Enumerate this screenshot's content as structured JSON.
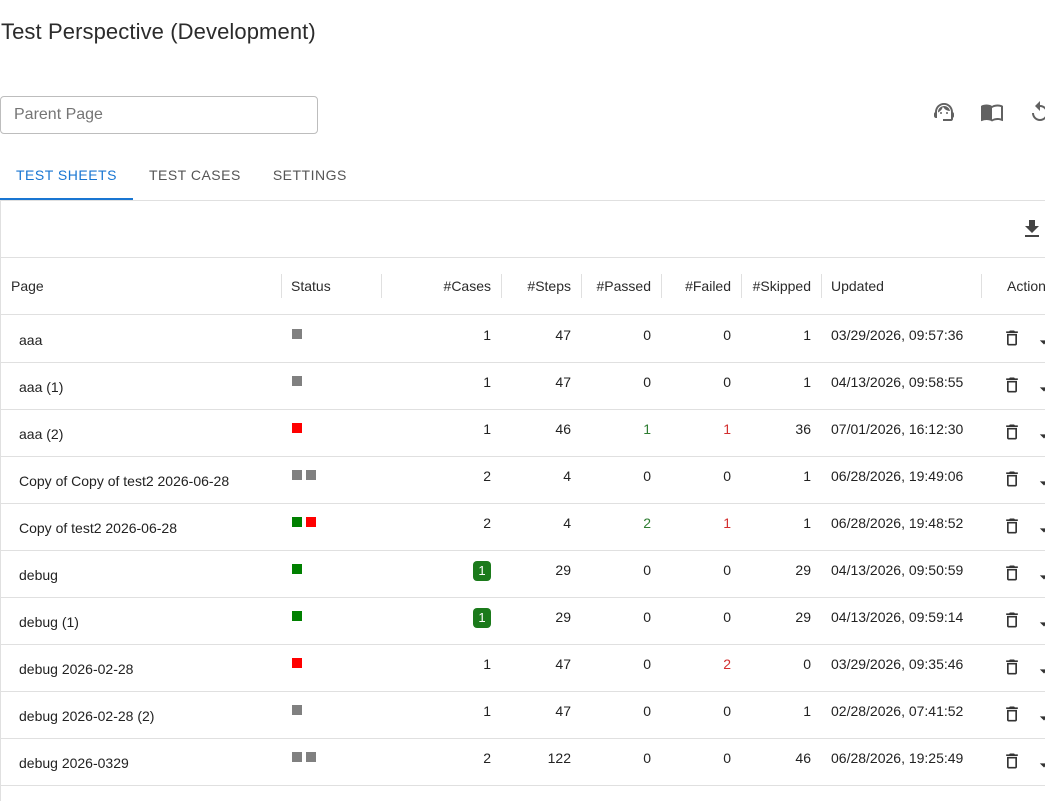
{
  "header": {
    "title": "Test Perspective (Development)"
  },
  "parent_input": {
    "placeholder": "Parent Page",
    "value": ""
  },
  "toolbar_icons": [
    "support-agent-icon",
    "book-icon",
    "refresh-icon"
  ],
  "tabs": [
    {
      "label": "TEST SHEETS",
      "active": true
    },
    {
      "label": "TEST CASES",
      "active": false
    },
    {
      "label": "SETTINGS",
      "active": false
    }
  ],
  "columns": {
    "page": "Page",
    "status": "Status",
    "cases": "#Cases",
    "steps": "#Steps",
    "passed": "#Passed",
    "failed": "#Failed",
    "skipped": "#Skipped",
    "updated": "Updated",
    "actions": "Action"
  },
  "colors": {
    "grey": "#808080",
    "green": "#008000",
    "red": "#ff0000",
    "accent": "#1976d2"
  },
  "rows": [
    {
      "page": "aaa",
      "status": [
        "grey"
      ],
      "cases": "1",
      "cases_badge": false,
      "steps": "47",
      "passed": "0",
      "failed": "0",
      "skipped": "1",
      "updated": "03/29/2026, 09:57:36"
    },
    {
      "page": "aaa (1)",
      "status": [
        "grey"
      ],
      "cases": "1",
      "cases_badge": false,
      "steps": "47",
      "passed": "0",
      "failed": "0",
      "skipped": "1",
      "updated": "04/13/2026, 09:58:55"
    },
    {
      "page": "aaa (2)",
      "status": [
        "red"
      ],
      "cases": "1",
      "cases_badge": false,
      "steps": "46",
      "passed": "1",
      "failed": "1",
      "skipped": "36",
      "updated": "07/01/2026, 16:12:30"
    },
    {
      "page": "Copy of Copy of test2 2026-06-28",
      "status": [
        "grey",
        "grey"
      ],
      "cases": "2",
      "cases_badge": false,
      "steps": "4",
      "passed": "0",
      "failed": "0",
      "skipped": "1",
      "updated": "06/28/2026, 19:49:06"
    },
    {
      "page": "Copy of test2 2026-06-28",
      "status": [
        "green",
        "red"
      ],
      "cases": "2",
      "cases_badge": false,
      "steps": "4",
      "passed": "2",
      "failed": "1",
      "skipped": "1",
      "updated": "06/28/2026, 19:48:52"
    },
    {
      "page": "debug",
      "status": [
        "green"
      ],
      "cases": "1",
      "cases_badge": true,
      "steps": "29",
      "passed": "0",
      "failed": "0",
      "skipped": "29",
      "updated": "04/13/2026, 09:50:59"
    },
    {
      "page": "debug (1)",
      "status": [
        "green"
      ],
      "cases": "1",
      "cases_badge": true,
      "steps": "29",
      "passed": "0",
      "failed": "0",
      "skipped": "29",
      "updated": "04/13/2026, 09:59:14"
    },
    {
      "page": "debug 2026-02-28",
      "status": [
        "red"
      ],
      "cases": "1",
      "cases_badge": false,
      "steps": "47",
      "passed": "0",
      "failed": "2",
      "skipped": "0",
      "updated": "03/29/2026, 09:35:46"
    },
    {
      "page": "debug 2026-02-28 (2)",
      "status": [
        "grey"
      ],
      "cases": "1",
      "cases_badge": false,
      "steps": "47",
      "passed": "0",
      "failed": "0",
      "skipped": "1",
      "updated": "02/28/2026, 07:41:52"
    },
    {
      "page": "debug 2026-0329",
      "status": [
        "grey",
        "grey"
      ],
      "cases": "2",
      "cases_badge": false,
      "steps": "122",
      "passed": "0",
      "failed": "0",
      "skipped": "46",
      "updated": "06/28/2026, 19:25:49"
    }
  ]
}
